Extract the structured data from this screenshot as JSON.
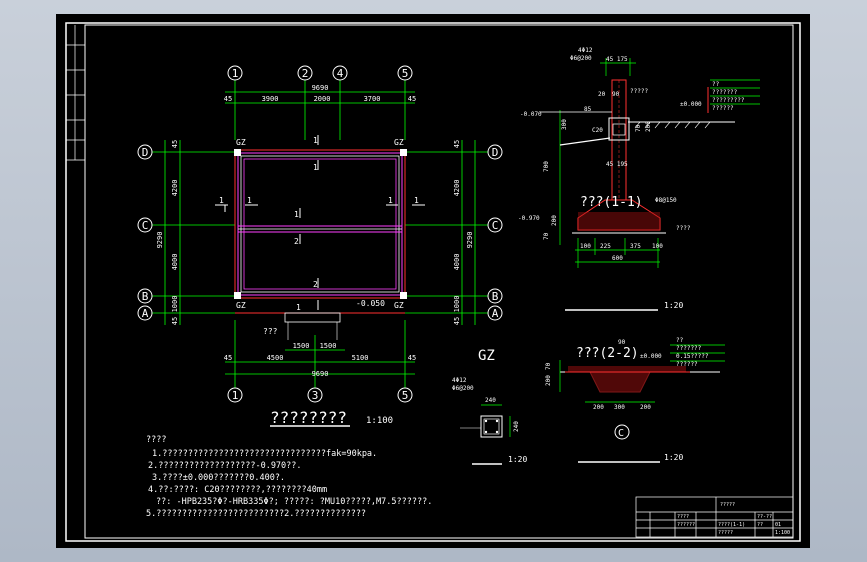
{
  "plan": {
    "top_axes": [
      "1",
      "2",
      "4",
      "5"
    ],
    "bottom_axes": [
      "1",
      "3",
      "5"
    ],
    "left_axes": [
      "D",
      "C",
      "B",
      "A"
    ],
    "right_axes": [
      "D",
      "C",
      "B",
      "A"
    ],
    "dim_top_total": "9690",
    "dim_top_parts": [
      "45",
      "3900",
      "2000",
      "3700",
      "45"
    ],
    "dim_bottom_parts": [
      "45",
      "4500",
      "5100",
      "45"
    ],
    "dim_bottom_total": "9690",
    "dim_bottom_door": [
      "1500",
      "1500"
    ],
    "dim_left_total": "9290",
    "dim_left_parts": [
      "45",
      "4200",
      "4000",
      "1000",
      "45"
    ],
    "dim_right_total": "9290",
    "dim_right_parts": [
      "45",
      "4200",
      "4000",
      "1000",
      "45"
    ],
    "gz_labels": [
      "GZ",
      "GZ",
      "GZ",
      "GZ"
    ],
    "section_marks": [
      "1",
      "1",
      "1",
      "2",
      "2",
      "1",
      "1",
      "1",
      "1",
      "1"
    ],
    "elev_entry": "-0.050",
    "stair_label": "???",
    "title": "????????",
    "scale": "1:100"
  },
  "notes": {
    "heading": "????",
    "lines": [
      "1.????????????????????????????????fak=90kpa.",
      "2.???????????????????-0.970??.",
      "3.????±0.000???????0.400?.",
      "4.??:????: C20????????,????????40mm",
      "??: -HPB235?Φ?-HRB335Φ?;  ?????: ?MU10?????,M7.5??????.",
      "5.?????????????????????????2.??????????????"
    ]
  },
  "gz": {
    "title": "GZ",
    "rebar": "4Φ12",
    "stirrup": "Φ6@200",
    "dim_w": "240",
    "dim_h": "240",
    "scale": "1:20"
  },
  "section1": {
    "title": "???(1-1)",
    "scale": "1:20",
    "rebar": "4Φ12",
    "stirrup": "Φ6@200",
    "dim_top": "45 175",
    "dims_left": [
      "300",
      "700",
      "70",
      "200"
    ],
    "dims_bottom": [
      "100",
      "225",
      "375",
      "100"
    ],
    "dim_base": "600",
    "elev_left": "-0.070",
    "elev_right": "±0.000",
    "elev_bottom": "-0.970",
    "wall_label": "45 195",
    "beam_label": "C20",
    "dim_bar": "85",
    "found_note": "Φ8@150",
    "ground_note": "????",
    "layer_notes": [
      "??",
      "???????",
      "?????????",
      "??????"
    ],
    "top_dims": [
      "20",
      "90"
    ],
    "top_note": "?????",
    "side_dims": [
      "70",
      "200"
    ]
  },
  "section2": {
    "title": "???(2-2)",
    "scale": "1:20",
    "elev": "±0.000",
    "dims_bottom": [
      "200",
      "300",
      "200"
    ],
    "dims_left": [
      "200",
      "70"
    ],
    "top_dim": "90",
    "layer_notes": [
      "??",
      "???????",
      "0.15?????",
      "??????"
    ],
    "detail_mark": "C"
  },
  "titleblock": {
    "cells": [
      "?????",
      "????",
      "??????",
      "????(1-1)",
      "?????",
      "??-??",
      "??",
      "01",
      "1:100"
    ]
  }
}
